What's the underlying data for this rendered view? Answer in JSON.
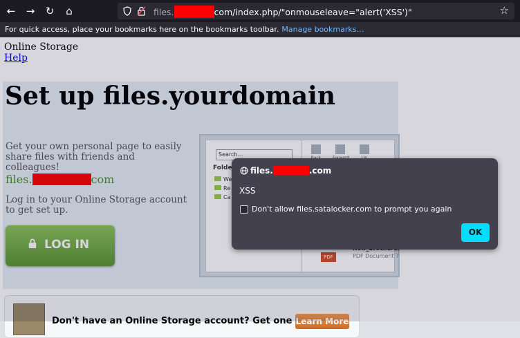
{
  "browser": {
    "url_prefix": "files.",
    "url_suffix": "com/index.php/\"onmouseleave=\"alert('XSS')\"",
    "bookmarks_text": "For quick access, place your bookmarks here on the bookmarks toolbar.",
    "bookmarks_link": "Manage bookmarks…"
  },
  "page": {
    "site_name": "Online Storage",
    "help": "Help",
    "heading": "Set up files.yourdomain",
    "description": "Get your own personal page to easily share files with friends and colleagues!",
    "domain_prefix": "files.",
    "domain_suffix": "com",
    "login_text": "Log in to your Online Storage account to get set up.",
    "login_button": "LOG IN",
    "preview": {
      "search_placeholder": "Search...",
      "toolbar": [
        "Back",
        "Forward",
        "Up"
      ],
      "folders_label": "Folde",
      "folders": [
        "We",
        "Re",
        "Ca"
      ],
      "pdf_badge": "PDF",
      "file_name": "New_Brochure.",
      "file_type": "PDF Document 7"
    },
    "signup_text": "Don't have an Online Storage account? Get one no",
    "learn_more": "Learn More"
  },
  "dialog": {
    "origin_prefix": "files.",
    "origin_suffix": ".com",
    "message": "XSS",
    "checkbox_label": "Don't allow files.satalocker.com to prompt you again",
    "ok": "OK"
  },
  "colors": {
    "dialog_bg": "#42414d",
    "ok_button": "#00ddff",
    "redaction": "#ff0000",
    "login_green": "#6aa63c"
  }
}
